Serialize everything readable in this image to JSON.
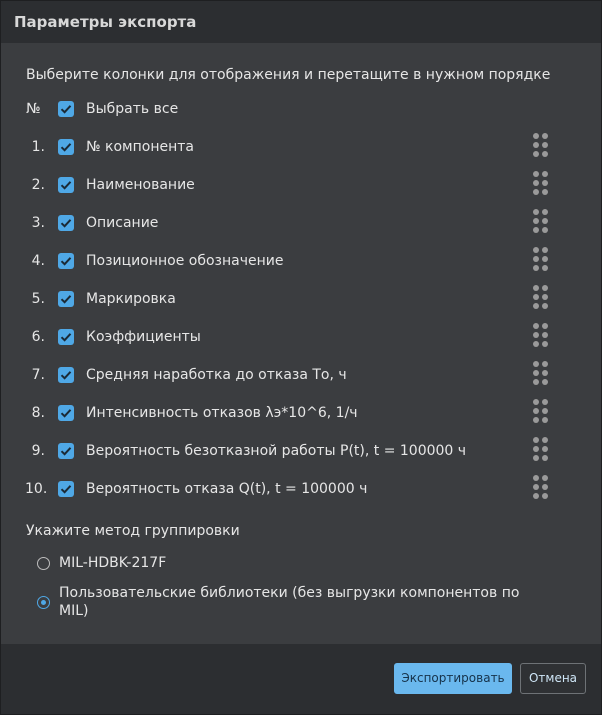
{
  "dialog": {
    "title": "Параметры экспорта",
    "instruction": "Выберите колонки для отображения и перетащите в нужном порядке",
    "header_row": {
      "num": "№",
      "label": "Выбрать все",
      "checked": true
    },
    "columns": [
      {
        "num": "1.",
        "label": "№ компонента",
        "checked": true
      },
      {
        "num": "2.",
        "label": "Наименование",
        "checked": true
      },
      {
        "num": "3.",
        "label": "Описание",
        "checked": true
      },
      {
        "num": "4.",
        "label": "Позиционное обозначение",
        "checked": true
      },
      {
        "num": "5.",
        "label": "Маркировка",
        "checked": true
      },
      {
        "num": "6.",
        "label": "Коэффициенты",
        "checked": true
      },
      {
        "num": "7.",
        "label": "Средняя наработка до отказа То, ч",
        "checked": true
      },
      {
        "num": "8.",
        "label": "Интенсивность отказов λэ*10^6, 1/ч",
        "checked": true
      },
      {
        "num": "9.",
        "label": "Вероятность безотказной работы P(t), t = 100000 ч",
        "checked": true
      },
      {
        "num": "10.",
        "label": "Вероятность отказа Q(t), t = 100000 ч",
        "checked": true
      }
    ],
    "grouping": {
      "title": "Укажите метод группировки",
      "options": [
        {
          "label": "MIL-HDBK-217F",
          "selected": false
        },
        {
          "label": "Пользовательские библиотеки (без выгрузки компонентов по MIL)",
          "selected": true
        }
      ]
    },
    "buttons": {
      "export": "Экспортировать",
      "cancel": "Отмена"
    },
    "colors": {
      "accent": "#4fa8e6",
      "primary_button": "#6ab8ee",
      "background": "#3b3d40",
      "titlebar": "#2c2e31"
    }
  }
}
